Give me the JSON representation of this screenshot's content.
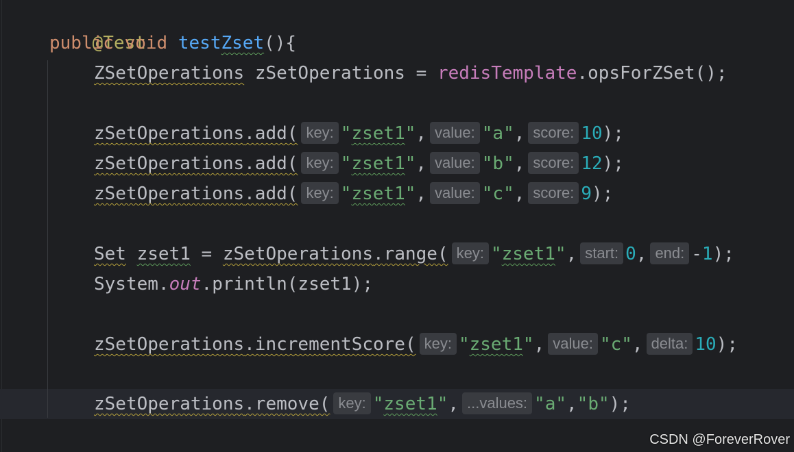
{
  "code": {
    "annotation": "@Test",
    "method": {
      "modifier_public": "public",
      "modifier_void": "void",
      "name_prefix": "test",
      "name_suffix": "Zset",
      "open": "(){"
    },
    "l3": {
      "type": "ZSetOperations",
      "space": " ",
      "var": "zSetOperations",
      "eq": " = ",
      "field": "redisTemplate",
      "rest": ".opsForZSet();"
    },
    "adds": [
      {
        "receiver": "zSetOperations",
        "call": ".add(",
        "hint_key": "key:",
        "key_value": "\"zset1\"",
        "sep1": ",",
        "hint_value": "value:",
        "member": "\"a\"",
        "sep2": ",",
        "hint_score": "score:",
        "score": "10",
        "close": ");"
      },
      {
        "receiver": "zSetOperations",
        "call": ".add(",
        "hint_key": "key:",
        "key_value": "\"zset1\"",
        "sep1": ",",
        "hint_value": "value:",
        "member": "\"b\"",
        "sep2": ",",
        "hint_score": "score:",
        "score": "12",
        "close": ");"
      },
      {
        "receiver": "zSetOperations",
        "call": ".add(",
        "hint_key": "key:",
        "key_value": "\"zset1\"",
        "sep1": ",",
        "hint_value": "value:",
        "member": "\"c\"",
        "sep2": ",",
        "hint_score": "score:",
        "score": "9",
        "close": ");"
      }
    ],
    "range": {
      "type": "Set",
      "var": "zset1",
      "eq": " = ",
      "receiver": "zSetOperations",
      "call": ".range(",
      "hint_key": "key:",
      "key_value": "\"zset1\"",
      "sep1": ",",
      "hint_start": "start:",
      "start": "0",
      "sep2": ",",
      "hint_end": "end:",
      "minus": "-",
      "end": "1",
      "close": ");"
    },
    "println": {
      "cls": "System.",
      "field": "out",
      "rest": ".println(zset1);"
    },
    "increment": {
      "receiver": "zSetOperations",
      "call": ".incrementScore(",
      "hint_key": "key:",
      "key_value": "\"zset1\"",
      "sep1": ",",
      "hint_value": "value:",
      "member": "\"c\"",
      "sep2": ",",
      "hint_delta": "delta:",
      "delta": "10",
      "close": ");"
    },
    "remove": {
      "receiver": "zSetOperations",
      "call": ".remove(",
      "hint_key": "key:",
      "key_value": "\"zset1\"",
      "sep1": ",",
      "hint_values": "...values:",
      "v1": "\"a\"",
      "sep2": ",",
      "v2": "\"b\"",
      "close": ");"
    },
    "closing": "}"
  },
  "watermark": "CSDN @ForeverRover",
  "colors": {
    "background": "#1e1f22",
    "keyword": "#cf8e6d",
    "annotation": "#b3ae60",
    "method_declaration": "#56a8f5",
    "field": "#c77dbb",
    "string": "#6aab73",
    "number": "#2aacb8",
    "default_text": "#bcbec4",
    "inlay_hint_bg": "#393b40",
    "inlay_hint_text": "#8a8c91",
    "warning_underline": "#b6a13b",
    "typo_underline": "#5e9d5c"
  }
}
